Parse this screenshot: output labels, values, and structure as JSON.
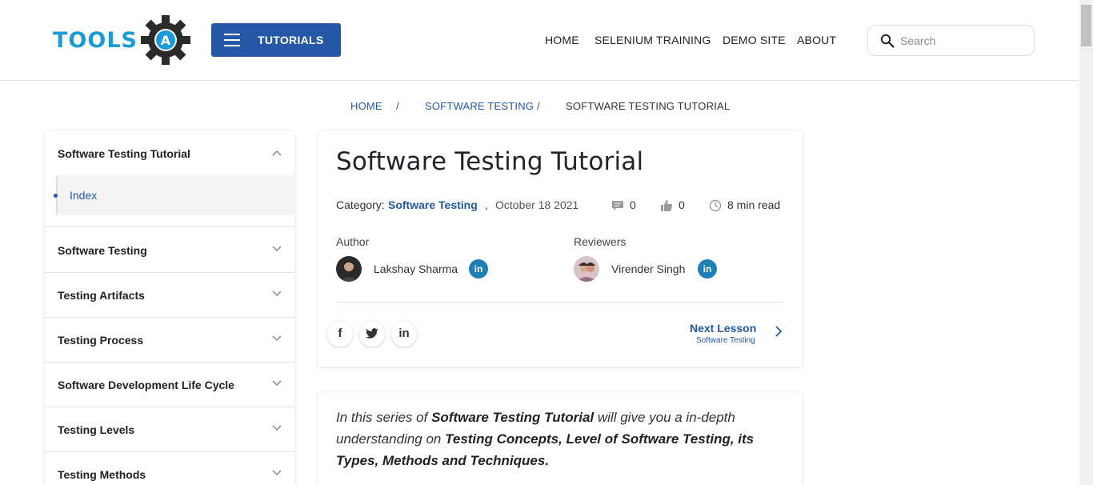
{
  "header": {
    "logo_text": "TOOLS",
    "logo_badge": "A",
    "tutorials_label": "TUTORIALS",
    "nav": [
      "HOME",
      "SELENIUM TRAINING",
      "DEMO SITE",
      "ABOUT"
    ],
    "search_placeholder": "Search"
  },
  "breadcrumb": {
    "items": [
      "HOME",
      "SOFTWARE TESTING",
      "SOFTWARE TESTING TUTORIAL"
    ],
    "separator": "/"
  },
  "sidebar": {
    "items": [
      "Software Testing Tutorial",
      "Software Testing",
      "Testing Artifacts",
      "Testing Process",
      "Software Development Life Cycle",
      "Testing Levels",
      "Testing Methods"
    ],
    "sub_item": "Index"
  },
  "article": {
    "title": "Software Testing Tutorial",
    "category_label": "Category:",
    "category": "Software Testing",
    "category_sep": ",",
    "date": "October 18 2021",
    "comments": "0",
    "likes": "0",
    "read_time": "8 min read",
    "author_label": "Author",
    "author_name": "Lakshay Sharma",
    "reviewers_label": "Reviewers",
    "reviewer_name": "Virender Singh",
    "linkedin_label": "in",
    "share": [
      "f",
      "t",
      "in"
    ],
    "next_lesson": "Next Lesson",
    "next_lesson_sub": "Software Testing"
  },
  "intro": {
    "p1": "In this series of ",
    "b1": "Software Testing Tutorial",
    "p2": " will give you a in-depth understanding on ",
    "b2": "Testing Concepts, Level of Software Testing, its Types, Methods and Techniques."
  },
  "colors": {
    "brand_blue": "#2458a6",
    "logo_blue": "#1a9bd7",
    "linkedin": "#1d7fb5"
  }
}
